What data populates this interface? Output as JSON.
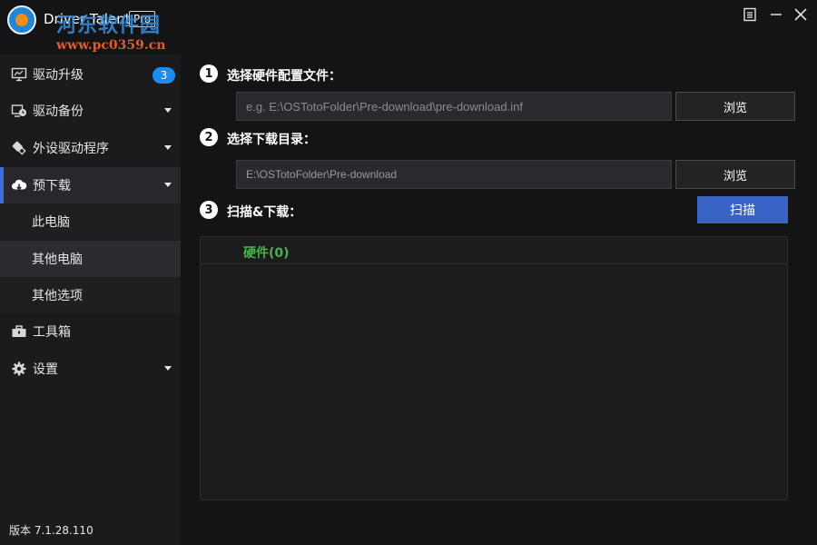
{
  "app": {
    "title": "Driver Talent",
    "edition": "Pro",
    "watermark_title": "河东软件园",
    "watermark_url": "www.pc0359.cn"
  },
  "window_controls": {
    "menu_icon": "menu-icon",
    "minimize_icon": "minimize-icon",
    "close_icon": "close-icon"
  },
  "sidebar": {
    "items": [
      {
        "label": "驱动升级",
        "icon": "monitor-icon",
        "badge": "3"
      },
      {
        "label": "驱动备份",
        "icon": "backup-clock-icon"
      },
      {
        "label": "外设驱动程序",
        "icon": "usb-device-icon"
      },
      {
        "label": "预下载",
        "icon": "cloud-download-icon"
      },
      {
        "label": "工具箱",
        "icon": "toolbox-icon"
      },
      {
        "label": "设置",
        "icon": "gear-icon"
      }
    ],
    "sub_items": [
      {
        "label": "此电脑"
      },
      {
        "label": "其他电脑"
      },
      {
        "label": "其他选项"
      }
    ],
    "version": "版本 7.1.28.110"
  },
  "main": {
    "steps": [
      {
        "num": "1",
        "label": "选择硬件配置文件："
      },
      {
        "num": "2",
        "label": "选择下载目录："
      },
      {
        "num": "3",
        "label": "扫描&下载："
      }
    ],
    "config_file_placeholder": "e.g. E:\\OSTotoFolder\\Pre-download\\pre-download.inf",
    "download_dir_value": "E:\\OSTotoFolder\\Pre-download",
    "browse_label": "浏览",
    "scan_label": "扫描",
    "hardware_header": "硬件(0)"
  },
  "colors": {
    "accent_blue": "#3a63c6",
    "badge_blue": "#1c8cf0",
    "active_bar": "#3b6fe0",
    "hardware_green": "#4caf50"
  }
}
